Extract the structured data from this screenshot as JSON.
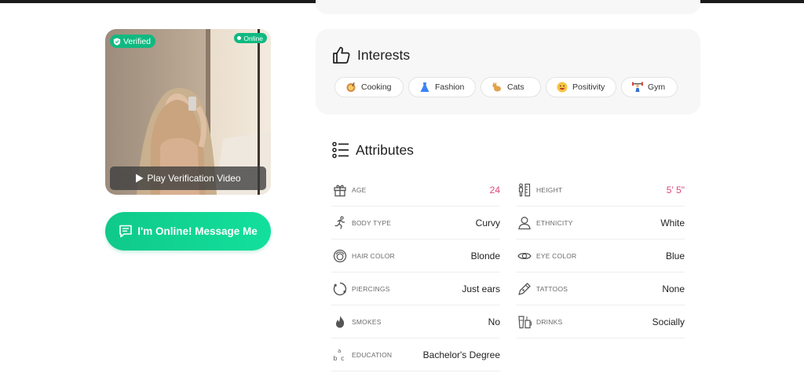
{
  "photo": {
    "verified_label": "Verified",
    "online_label": "Online",
    "play_label": "Play Verification Video"
  },
  "message_button": {
    "label": "I'm Online! Message Me"
  },
  "interests": {
    "title": "Interests",
    "items": [
      {
        "label": "Cooking",
        "icon": "cooking-icon"
      },
      {
        "label": "Fashion",
        "icon": "dress-icon"
      },
      {
        "label": "Cats",
        "icon": "cat-icon"
      },
      {
        "label": "Positivity",
        "icon": "smile-icon"
      },
      {
        "label": "Gym",
        "icon": "weightlifter-icon"
      }
    ]
  },
  "attributes": {
    "title": "Attributes",
    "left": [
      {
        "label": "AGE",
        "value": "24",
        "icon": "gift-icon",
        "highlight": true
      },
      {
        "label": "BODY TYPE",
        "value": "Curvy",
        "icon": "runner-icon"
      },
      {
        "label": "HAIR COLOR",
        "value": "Blonde",
        "icon": "hair-icon"
      },
      {
        "label": "PIERCINGS",
        "value": "Just ears",
        "icon": "ring-icon"
      },
      {
        "label": "SMOKES",
        "value": "No",
        "icon": "flame-icon"
      },
      {
        "label": "EDUCATION",
        "value": "Bachelor's Degree",
        "icon": "abc-icon"
      }
    ],
    "right": [
      {
        "label": "HEIGHT",
        "value": "5' 5\"",
        "icon": "height-icon",
        "highlight": true
      },
      {
        "label": "ETHNICITY",
        "value": "White",
        "icon": "person-icon"
      },
      {
        "label": "EYE COLOR",
        "value": "Blue",
        "icon": "eye-icon"
      },
      {
        "label": "TATTOOS",
        "value": "None",
        "icon": "pen-icon"
      },
      {
        "label": "DRINKS",
        "value": "Socially",
        "icon": "drink-icon"
      }
    ]
  },
  "colors": {
    "accent": "#10b981",
    "highlight": "#e0457b"
  }
}
